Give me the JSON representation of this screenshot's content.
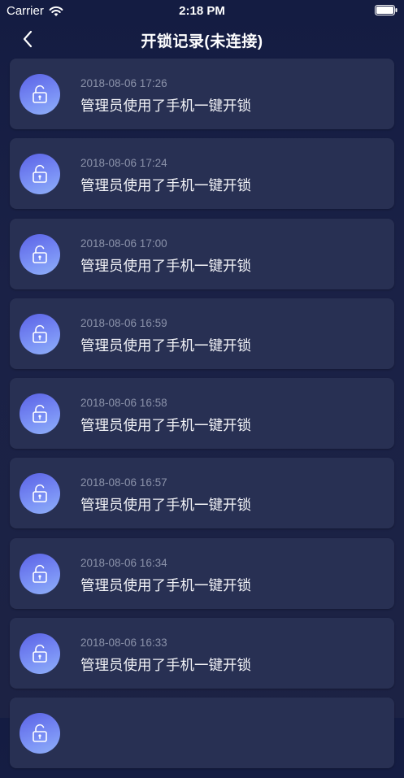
{
  "status_bar": {
    "carrier": "Carrier",
    "time": "2:18 PM"
  },
  "nav": {
    "title": "开锁记录(未连接)",
    "back_icon": "chevron-left-icon"
  },
  "records": [
    {
      "date": "2018-08-06 17:26",
      "text": "管理员使用了手机一键开锁"
    },
    {
      "date": "2018-08-06 17:24",
      "text": "管理员使用了手机一键开锁"
    },
    {
      "date": "2018-08-06 17:00",
      "text": "管理员使用了手机一键开锁"
    },
    {
      "date": "2018-08-06 16:59",
      "text": "管理员使用了手机一键开锁"
    },
    {
      "date": "2018-08-06 16:58",
      "text": "管理员使用了手机一键开锁"
    },
    {
      "date": "2018-08-06 16:57",
      "text": "管理员使用了手机一键开锁"
    },
    {
      "date": "2018-08-06 16:34",
      "text": "管理员使用了手机一键开锁"
    },
    {
      "date": "2018-08-06 16:33",
      "text": "管理员使用了手机一键开锁"
    },
    {
      "date": "",
      "text": ""
    }
  ],
  "colors": {
    "background": "#1a2146",
    "card": "#283053",
    "icon_gradient_start": "#5b62e6",
    "icon_gradient_end": "#8fb0f8",
    "date_text": "#8b92aa"
  }
}
